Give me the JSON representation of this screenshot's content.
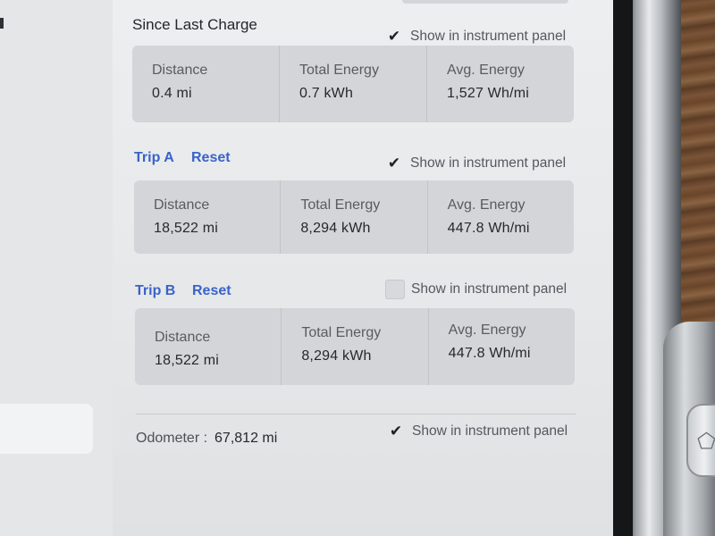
{
  "since_last_charge": {
    "title": "Since Last Charge",
    "show_label": "Show in instrument panel",
    "show_checked": true,
    "stats": [
      {
        "label": "Distance",
        "value": "0.4  mi"
      },
      {
        "label": "Total Energy",
        "value": "0.7  kWh"
      },
      {
        "label": "Avg. Energy",
        "value": "1,527  Wh/mi"
      }
    ]
  },
  "trip_a": {
    "title": "Trip A",
    "reset_label": "Reset",
    "show_label": "Show in instrument panel",
    "show_checked": true,
    "stats": [
      {
        "label": "Distance",
        "value": "18,522  mi"
      },
      {
        "label": "Total Energy",
        "value": "8,294  kWh"
      },
      {
        "label": "Avg. Energy",
        "value": "447.8  Wh/mi"
      }
    ]
  },
  "trip_b": {
    "title": "Trip B",
    "reset_label": "Reset",
    "show_label": "Show in instrument panel",
    "show_checked": false,
    "stats": [
      {
        "label": "Distance",
        "value": "18,522  mi"
      },
      {
        "label": "Total Energy",
        "value": "8,294  kWh"
      },
      {
        "label": "Avg. Energy",
        "value": "447.8  Wh/mi"
      }
    ]
  },
  "odometer": {
    "label": "Odometer  :",
    "value": "67,812  mi",
    "show_label": "Show in instrument panel",
    "show_checked": true
  },
  "icons": {
    "checkmark": "✔",
    "bezel_button": "⬠"
  },
  "colors": {
    "accent_link": "#3a63c8",
    "card_bg": "#d3d5d9",
    "screen_bg": "#eceef0"
  }
}
